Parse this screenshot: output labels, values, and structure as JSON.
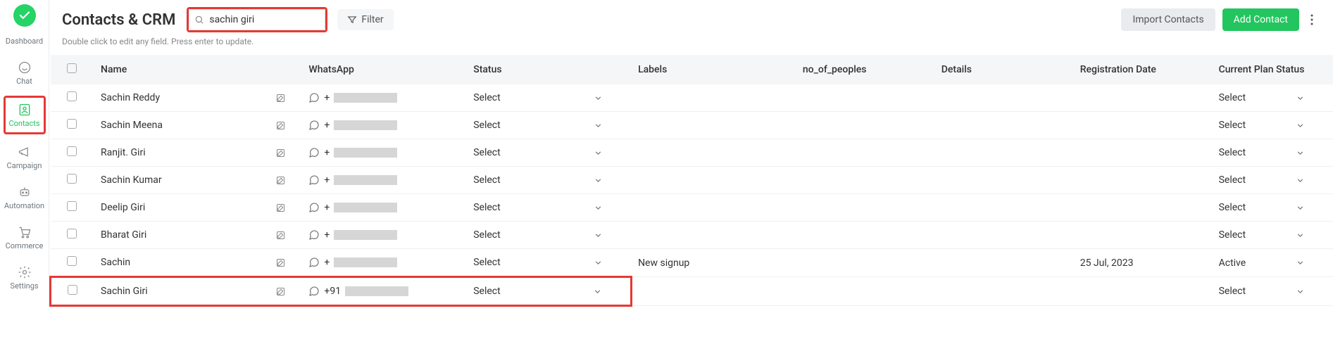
{
  "sidebar": {
    "items": [
      {
        "label": "Dashboard"
      },
      {
        "label": "Chat"
      },
      {
        "label": "Contacts"
      },
      {
        "label": "Campaign"
      },
      {
        "label": "Automation"
      },
      {
        "label": "Commerce"
      },
      {
        "label": "Settings"
      }
    ]
  },
  "header": {
    "title": "Contacts & CRM",
    "search_value": "sachin giri",
    "search_placeholder": "",
    "filter_label": "Filter",
    "import_label": "Import Contacts",
    "add_label": "Add Contact",
    "subtitle": "Double click to edit any field. Press enter to update."
  },
  "table": {
    "columns": {
      "name": "Name",
      "whatsapp": "WhatsApp",
      "status": "Status",
      "labels": "Labels",
      "no_of_peoples": "no_of_peoples",
      "details": "Details",
      "registration_date": "Registration Date",
      "current_plan_status": "Current Plan Status"
    },
    "rows": [
      {
        "name": "Sachin Reddy",
        "wa_prefix": "+",
        "status": "Select",
        "labels": "",
        "nop": "",
        "details": "",
        "reg": "",
        "plan": "Select"
      },
      {
        "name": "Sachin Meena",
        "wa_prefix": "+",
        "status": "Select",
        "labels": "",
        "nop": "",
        "details": "",
        "reg": "",
        "plan": "Select"
      },
      {
        "name": "Ranjit. Giri",
        "wa_prefix": "+",
        "status": "Select",
        "labels": "",
        "nop": "",
        "details": "",
        "reg": "",
        "plan": "Select"
      },
      {
        "name": "Sachin Kumar",
        "wa_prefix": "+",
        "status": "Select",
        "labels": "",
        "nop": "",
        "details": "",
        "reg": "",
        "plan": "Select"
      },
      {
        "name": "Deelip Giri",
        "wa_prefix": "+",
        "status": "Select",
        "labels": "",
        "nop": "",
        "details": "",
        "reg": "",
        "plan": "Select"
      },
      {
        "name": "Bharat Giri",
        "wa_prefix": "+",
        "status": "Select",
        "labels": "",
        "nop": "",
        "details": "",
        "reg": "",
        "plan": "Select"
      },
      {
        "name": "Sachin",
        "wa_prefix": "+",
        "status": "Select",
        "labels": "New signup",
        "nop": "",
        "details": "",
        "reg": "25 Jul, 2023",
        "plan": "Active"
      },
      {
        "name": "Sachin Giri",
        "wa_prefix": "+91",
        "status": "Select",
        "labels": "",
        "nop": "",
        "details": "",
        "reg": "",
        "plan": "Select"
      }
    ]
  }
}
